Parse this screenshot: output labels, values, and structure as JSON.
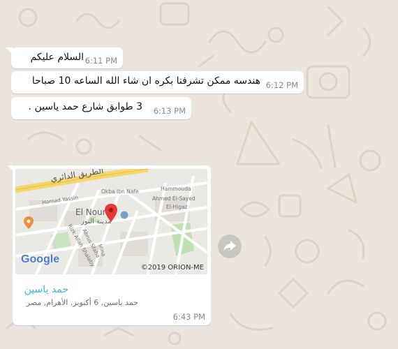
{
  "messages": [
    {
      "text": "السلام عليكم",
      "time": "6:11 PM"
    },
    {
      "text": "هندسه ممكن تشرفنا بكره ان شاء الله الساعه 10 صباحا",
      "time": "6:12 PM"
    },
    {
      "text": "3 طوابق شارع حمد ياسين .",
      "time": "6:13 PM"
    }
  ],
  "location": {
    "name": "حمد ياسين",
    "address": "حمد ياسين, 6 أكتوبر, الأهرام, مصر",
    "time": "6:43 PM",
    "map": {
      "road_label": "الطريق الدائري",
      "streets": [
        "Hammouda",
        "Okba Ibn Nafe",
        "Hamad Yassin",
        "Ahmed El-Sayed",
        "El-Higaz",
        "Rizk Allah Shalaby",
        "Abrus Sfaha",
        "Mina"
      ],
      "place_en": "El Nour",
      "place_ar": "مدينة النور",
      "google": "Google",
      "copyright": "©2019 ORION-ME"
    }
  },
  "colors": {
    "wallpaper": "#ece5dd",
    "bubble": "#ffffff",
    "link": "#34b7f1",
    "pin": "#e53935"
  },
  "icons": {
    "share": "forward-arrow-icon",
    "pin": "map-pin-icon"
  }
}
